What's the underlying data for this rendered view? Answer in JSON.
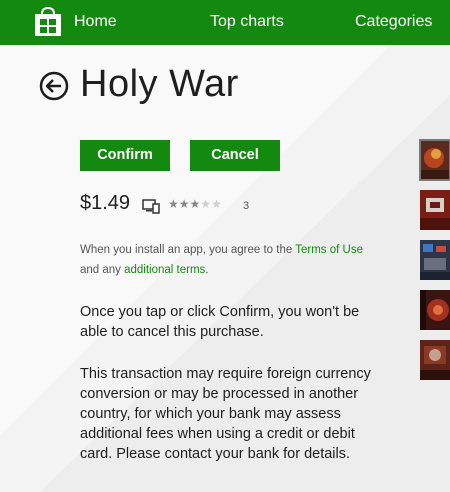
{
  "nav": {
    "home": "Home",
    "top_charts": "Top charts",
    "categories": "Categories"
  },
  "app": {
    "title": "Holy War",
    "price": "$1.49",
    "rating": 3,
    "rating_max": 5,
    "rating_count": "3"
  },
  "actions": {
    "confirm": "Confirm",
    "cancel": "Cancel"
  },
  "legal": {
    "part1": "When you install an app, you agree to the ",
    "terms_link": "Terms of Use",
    "part2": " and any ",
    "additional_link": "additional terms",
    "part3": "."
  },
  "messages": {
    "cancel_notice": "Once you tap or click Confirm, you won't be able to cancel this purchase.",
    "currency_notice": "This transaction may require foreign currency conversion or may be processed in another country, for which your bank may assess additional fees when using a credit or debit card. Please contact your bank for details."
  },
  "icons": {
    "store": "store-bag-icon",
    "back": "back-arrow-icon",
    "device": "pc-device-icon"
  },
  "colors": {
    "brand": "#138a0f",
    "background": "#ededed"
  }
}
